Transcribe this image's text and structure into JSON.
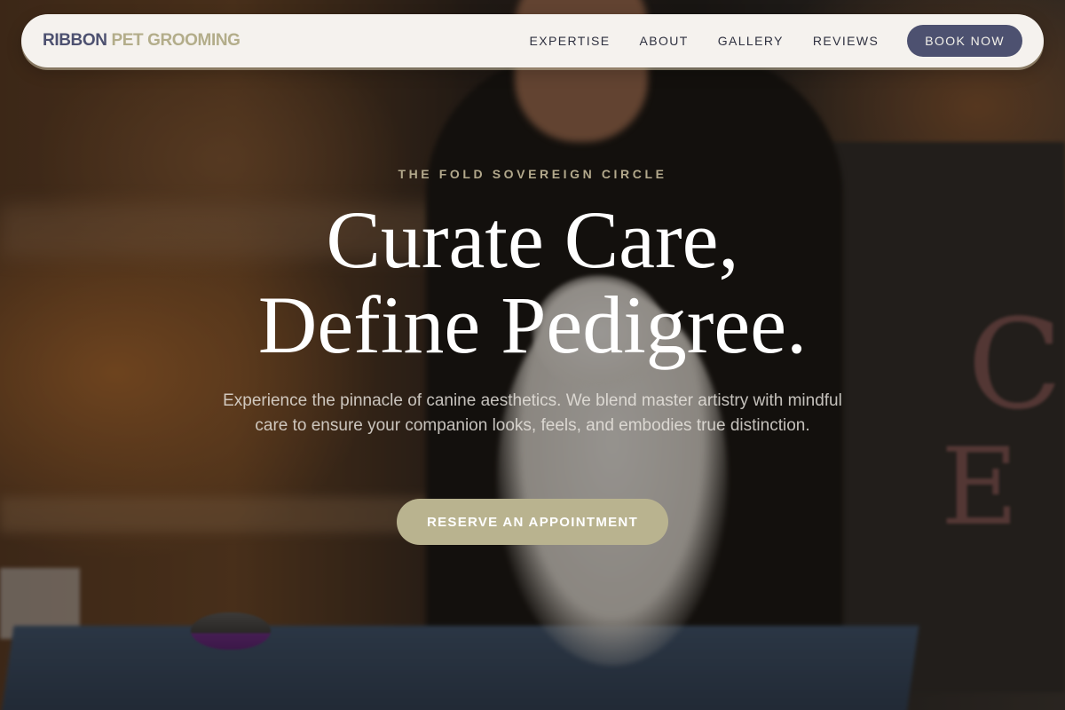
{
  "navbar": {
    "brand_primary": "RIBBON",
    "brand_accent": "PET GROOMING",
    "links": [
      "EXPERTISE",
      "ABOUT",
      "GALLERY",
      "REVIEWS"
    ],
    "cta_label": "BOOK NOW"
  },
  "hero": {
    "eyebrow": "THE FOLD SOVEREIGN CIRCLE",
    "headline_line1": "Curate Care,",
    "headline_line2": "Define Pedigree.",
    "subtext": "Experience the pinnacle of canine aesthetics. We blend master artistry with mindful care to ensure your companion looks, feels, and embodies true distinction.",
    "cta_label": "RESERVE AN APPOINTMENT"
  },
  "colors": {
    "brand_navy": "#4d5170",
    "brand_sand": "#b3ad8a",
    "cta_sand": "#b9b38f",
    "navbar_bg": "#f5f2ee"
  }
}
